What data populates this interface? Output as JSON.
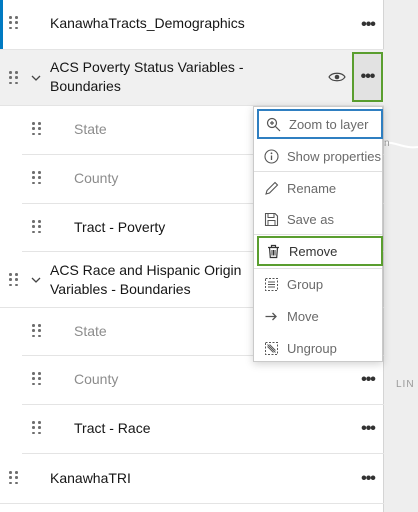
{
  "layers": {
    "top": {
      "label": "KanawhaTracts_Demographics"
    },
    "poverty_group": {
      "label_line1": "ACS Poverty Status Variables -",
      "label_line2": "Boundaries",
      "children": [
        {
          "label": "State"
        },
        {
          "label": "County"
        },
        {
          "label": "Tract - Poverty"
        }
      ]
    },
    "race_group": {
      "label_line1": "ACS Race and Hispanic Origin",
      "label_line2": "Variables - Boundaries",
      "children": [
        {
          "label": "State"
        },
        {
          "label": "County"
        },
        {
          "label": "Tract - Race"
        }
      ]
    },
    "bottom": {
      "label": "KanawhaTRI"
    }
  },
  "more_glyph": "•••",
  "menu": {
    "items": [
      {
        "label": "Zoom to layer",
        "icon": "zoom-in-icon"
      },
      {
        "label": "Show properties",
        "icon": "info-icon"
      },
      {
        "label": "Rename",
        "icon": "pencil-icon"
      },
      {
        "label": "Save as",
        "icon": "save-icon"
      },
      {
        "label": "Remove",
        "icon": "trash-icon"
      },
      {
        "label": "Group",
        "icon": "group-icon"
      },
      {
        "label": "Move",
        "icon": "arrow-right-icon"
      },
      {
        "label": "Ungroup",
        "icon": "ungroup-icon"
      }
    ]
  },
  "map": {
    "fragment_top": "n",
    "fragment_bottom": "LIN"
  },
  "colors": {
    "accent": "#007ac2",
    "highlight_green": "#5a9e2f",
    "highlight_blue": "#2f7fc1"
  }
}
